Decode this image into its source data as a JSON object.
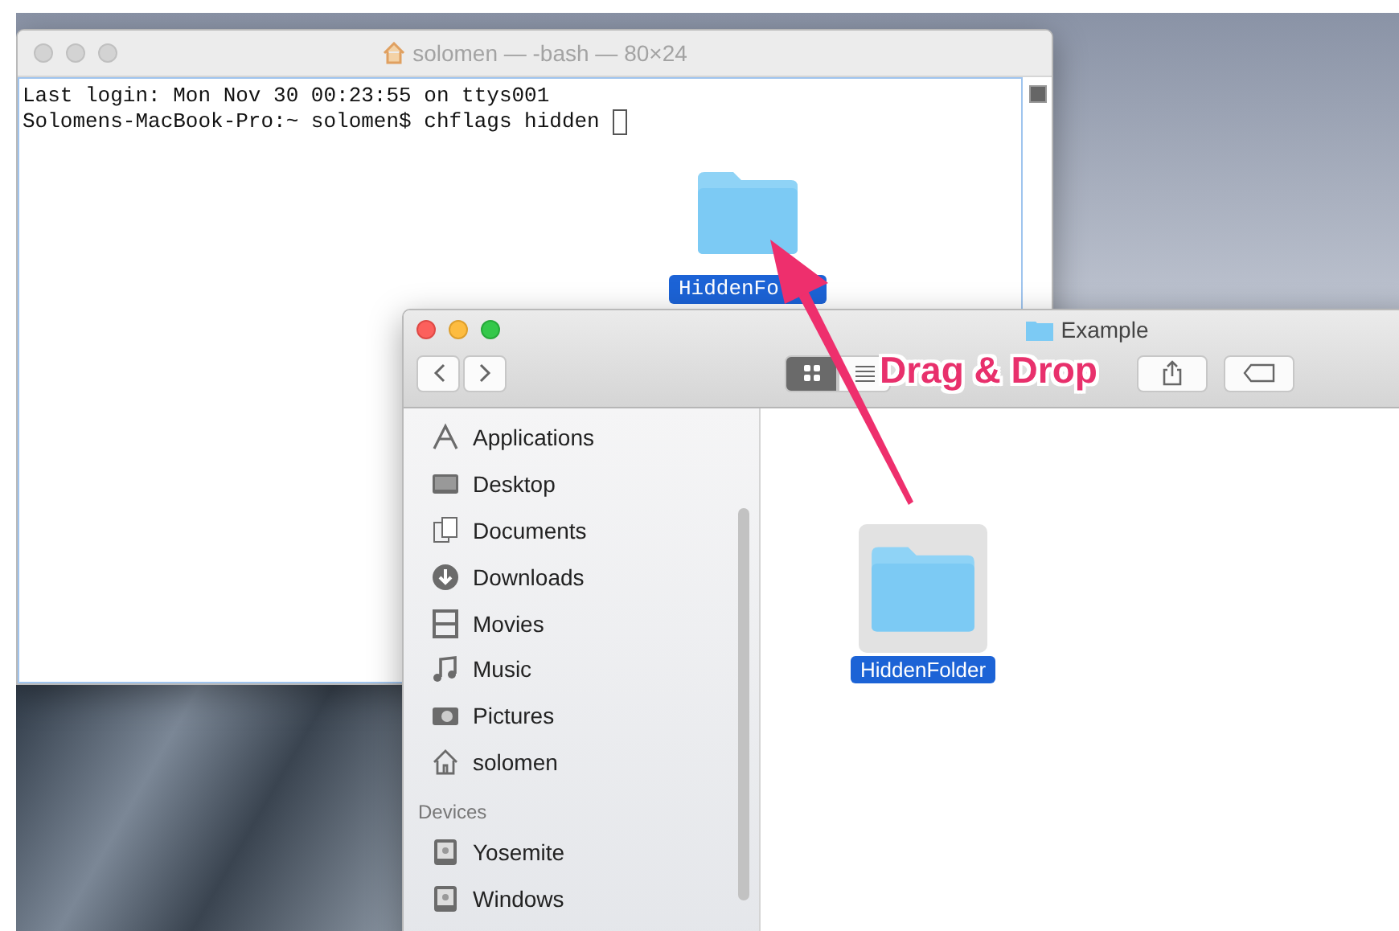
{
  "terminal": {
    "title": "solomen — -bash — 80×24",
    "lines": [
      "Last login: Mon Nov 30 00:23:55 on ttys001",
      "Solomens-MacBook-Pro:~ solomen$ chflags hidden "
    ],
    "dragged_item": {
      "label": "HiddenFo"
    }
  },
  "finder": {
    "title": "Example",
    "views": [
      {
        "kind": "icon",
        "selected": true
      },
      {
        "kind": "list",
        "selected": false
      }
    ],
    "favorites": [
      {
        "kind": "applications",
        "label": "Applications"
      },
      {
        "kind": "desktop",
        "label": "Desktop"
      },
      {
        "kind": "documents",
        "label": "Documents"
      },
      {
        "kind": "downloads",
        "label": "Downloads"
      },
      {
        "kind": "movies",
        "label": "Movies"
      },
      {
        "kind": "music",
        "label": "Music"
      },
      {
        "kind": "pictures",
        "label": "Pictures"
      },
      {
        "kind": "home",
        "label": "solomen"
      }
    ],
    "devices": {
      "header": "Devices",
      "items": [
        {
          "kind": "disk",
          "label": "Yosemite"
        },
        {
          "kind": "disk",
          "label": "Windows"
        }
      ]
    },
    "files": [
      {
        "name": "HiddenFolder",
        "selected": true
      }
    ]
  },
  "annotation": {
    "text": "Drag & Drop"
  }
}
